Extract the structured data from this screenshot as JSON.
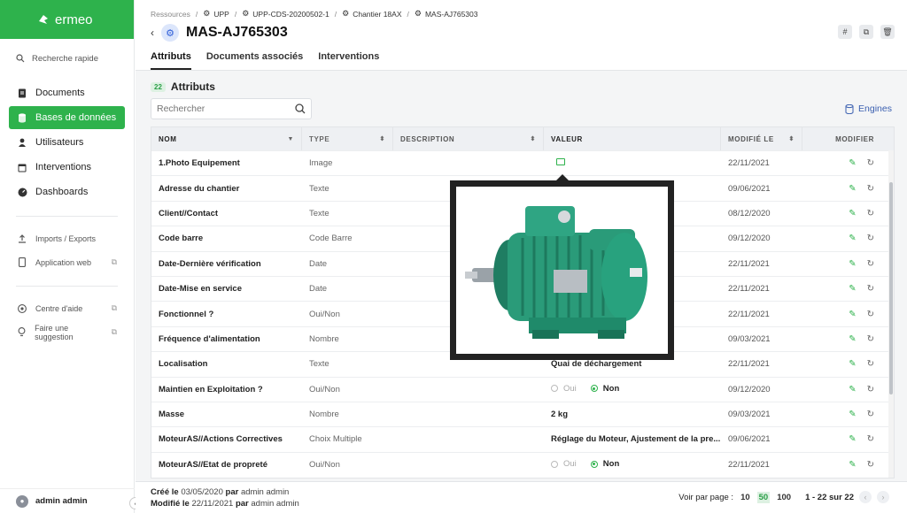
{
  "brand": {
    "name": "ermeo",
    "color": "#2eb24c"
  },
  "sidebar": {
    "quick_search": "Recherche rapide",
    "main_items": [
      {
        "label": "Documents",
        "icon": "document-icon"
      },
      {
        "label": "Bases de données",
        "icon": "database-icon",
        "active": true
      },
      {
        "label": "Utilisateurs",
        "icon": "user-icon"
      },
      {
        "label": "Interventions",
        "icon": "calendar-icon"
      },
      {
        "label": "Dashboards",
        "icon": "dashboard-icon"
      }
    ],
    "tools": [
      {
        "label": "Imports / Exports",
        "icon": "upload-icon"
      },
      {
        "label": "Application web",
        "icon": "mobile-icon"
      }
    ],
    "help": [
      {
        "label": "Centre d'aide",
        "icon": "help-icon"
      },
      {
        "label": "Faire une suggestion",
        "icon": "lightbulb-icon"
      }
    ],
    "user": "admin admin"
  },
  "header": {
    "breadcrumb": [
      "Ressources",
      "UPP",
      "UPP-CDS-20200502-1",
      "Chantier 18AX",
      "MAS-AJ765303"
    ],
    "title": "MAS-AJ765303",
    "tabs": [
      "Attributs",
      "Documents associés",
      "Interventions"
    ]
  },
  "section": {
    "count": "22",
    "title": "Attributs"
  },
  "search": {
    "placeholder": "Rechercher"
  },
  "engines_label": "Engines",
  "table": {
    "headers": {
      "nom": "NOM",
      "type": "TYPE",
      "description": "DESCRIPTION",
      "valeur": "VALEUR",
      "modifie": "MODIFIÉ LE",
      "modifier": "MODIFIER"
    },
    "rows": [
      {
        "nom": "1.Photo Equipement",
        "type": "Image",
        "valeur": "",
        "date": "22/11/2021",
        "kind": "image"
      },
      {
        "nom": "Adresse du chantier",
        "type": "Texte",
        "valeur": "",
        "date": "09/06/2021"
      },
      {
        "nom": "Client//Contact",
        "type": "Texte",
        "valeur": "",
        "date": "08/12/2020"
      },
      {
        "nom": "Code barre",
        "type": "Code Barre",
        "valeur": "",
        "date": "09/12/2020"
      },
      {
        "nom": "Date-Dernière vérification",
        "type": "Date",
        "valeur": "",
        "date": "22/11/2021"
      },
      {
        "nom": "Date-Mise en service",
        "type": "Date",
        "valeur": "",
        "date": "22/11/2021"
      },
      {
        "nom": "Fonctionnel ?",
        "type": "Oui/Non",
        "valeur": "",
        "date": "22/11/2021"
      },
      {
        "nom": "Fréquence d'alimentation",
        "type": "Nombre",
        "valeur": "",
        "date": "09/03/2021"
      },
      {
        "nom": "Localisation",
        "type": "Texte",
        "valeur": "Quai de déchargement",
        "date": "22/11/2021"
      },
      {
        "nom": "Maintien en Exploitation ?",
        "type": "Oui/Non",
        "valeur": "",
        "date": "09/12/2020",
        "kind": "bool",
        "oui": "Oui",
        "non": "Non"
      },
      {
        "nom": "Masse",
        "type": "Nombre",
        "valeur": "2 kg",
        "date": "09/03/2021"
      },
      {
        "nom": "MoteurAS//Actions Correctives",
        "type": "Choix Multiple",
        "valeur": "Réglage du Moteur, Ajustement de la pre...",
        "date": "09/06/2021"
      },
      {
        "nom": "MoteurAS//Etat de propreté",
        "type": "Oui/Non",
        "valeur": "",
        "date": "22/11/2021",
        "kind": "bool",
        "oui": "Oui",
        "non": "Non"
      }
    ]
  },
  "footer": {
    "created_label": "Créé le",
    "created_date": "03/05/2020",
    "created_by_label": "par",
    "created_by": "admin admin",
    "modified_label": "Modifié le",
    "modified_date": "22/11/2021",
    "modified_by_label": "par",
    "modified_by": "admin admin",
    "per_page_label": "Voir par page :",
    "page_sizes": [
      "10",
      "50",
      "100"
    ],
    "active_page_size": "50",
    "range": "1 - 22 sur 22"
  },
  "colors": {
    "accent": "#2eb24c",
    "link": "#3a5fb0"
  }
}
